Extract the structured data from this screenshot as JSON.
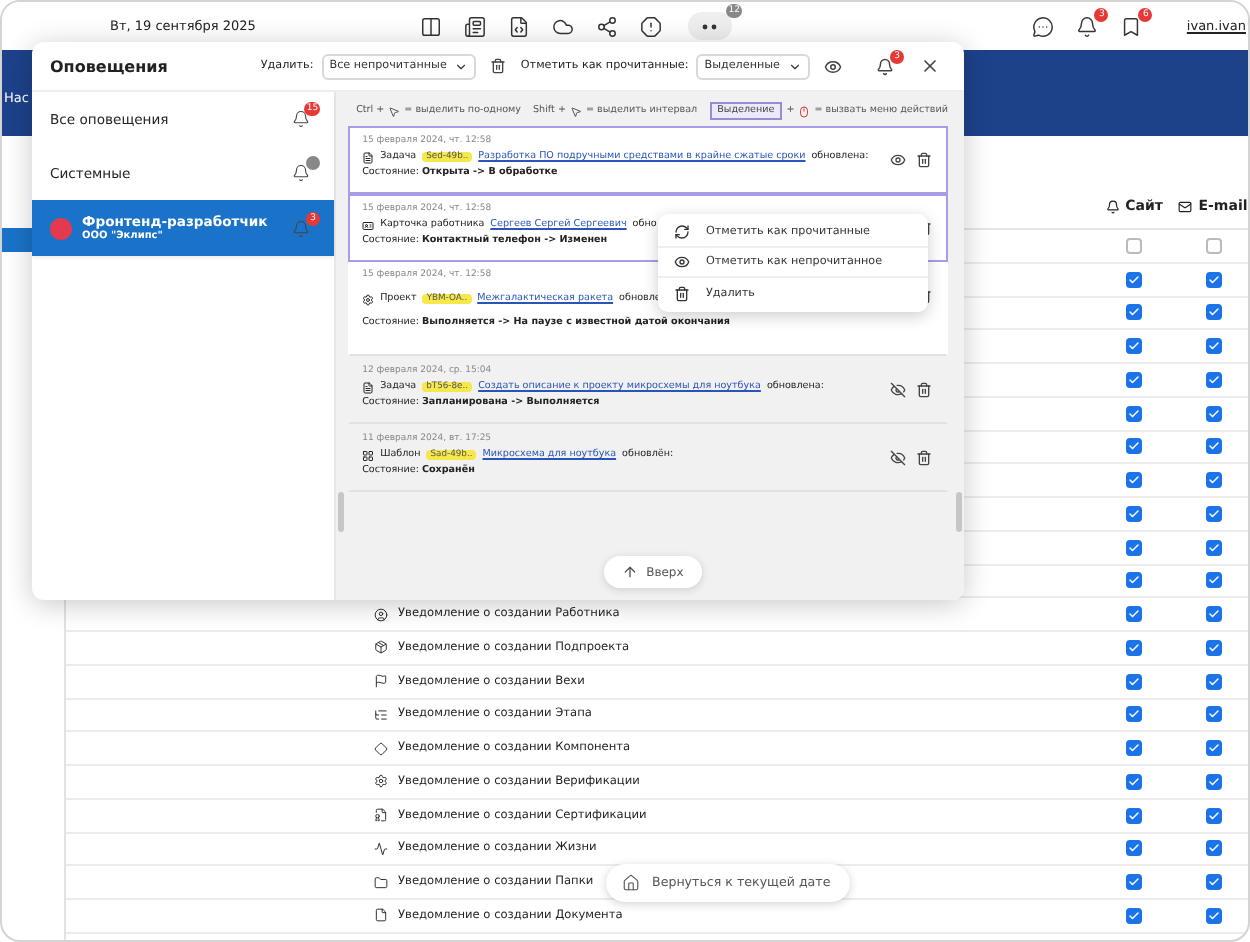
{
  "topbar": {
    "date": "Вт, 19 сентября 2025",
    "more_badge": "12",
    "notifications_badge": "3",
    "bookmarks_badge": "6",
    "user": "ivan.ivan"
  },
  "nav": {
    "tab": "Нас"
  },
  "table": {
    "columns": [
      {
        "label": "Сайт"
      },
      {
        "label": "E-mail"
      }
    ],
    "rows": [
      {
        "site": false,
        "email": false
      },
      {
        "site": true,
        "email": true
      },
      {
        "site": true,
        "email": true
      },
      {
        "site": true,
        "email": true
      },
      {
        "site": true,
        "email": true
      },
      {
        "site": true,
        "email": true
      },
      {
        "site": true,
        "email": true
      },
      {
        "site": true,
        "email": true
      },
      {
        "site": true,
        "email": true
      },
      {
        "site": true,
        "email": true
      },
      {
        "site": true,
        "email": true
      },
      {
        "label": "Уведомление о создании Работника",
        "site": true,
        "email": true
      },
      {
        "label": "Уведомление о создании Подпроекта",
        "site": true,
        "email": true
      },
      {
        "label": "Уведомление о создании Вехи",
        "site": true,
        "email": true
      },
      {
        "label": "Уведомление о создании Этапа",
        "site": true,
        "email": true
      },
      {
        "label": "Уведомление о создании Компонента",
        "site": true,
        "email": true
      },
      {
        "label": "Уведомление о создании Верификации",
        "site": true,
        "email": true
      },
      {
        "label": "Уведомление о создании Сертификации",
        "site": true,
        "email": true
      },
      {
        "label": "Уведомление о создании Жизни",
        "site": true,
        "email": true
      },
      {
        "label": "Уведомление о создании Папки",
        "site": true,
        "email": true
      },
      {
        "label": "Уведомление о создании Документа",
        "site": true,
        "email": true
      }
    ]
  },
  "popup": {
    "title": "Оповещения",
    "delete_label": "Удалить:",
    "delete_select": "Все непрочитанные",
    "mark_label": "Отметить как прочитанные:",
    "mark_select": "Выделенные",
    "bell_badge": "3",
    "channels": [
      {
        "name": "Все оповещения",
        "has_unread": true,
        "badge": "15",
        "selected": false
      },
      {
        "name": "Системные",
        "has_unread": false,
        "selected": false
      },
      {
        "name": "Фронтенд-разработчик",
        "org": "ООО \"Эклипс\"",
        "has_unread": true,
        "badge": "3",
        "selected": true
      }
    ],
    "hints": [
      {
        "kind": "key",
        "key": "Ctrl +",
        "action": "= выделить по-одному"
      },
      {
        "kind": "key",
        "key": "Shift +",
        "action": "= выделить интервал"
      },
      {
        "kind": "chip",
        "key": "Выделение",
        "plus": "+",
        "action": "= вызвать меню действий"
      }
    ],
    "cards": [
      {
        "date": "15 февраля 2024, чт. 12:58",
        "type": "Задача",
        "tag": "Sed-49b..",
        "link": "Разработка ПО подручными средствами в крайне сжатые сроки",
        "verb": "обновлена:",
        "state": "Состояние: **Открыта -> В обработке**",
        "selected": true,
        "read": false
      },
      {
        "date": "15 февраля 2024, чт. 12:58",
        "type": "Карточка работника",
        "link": "Сергеев Сергей Сергеевич",
        "verb": "обно",
        "state": "Состояние: **Контактный телефон -> Изменен**",
        "selected": true,
        "read": false
      },
      {
        "date": "15 февраля 2024, чт. 12:58",
        "type": "Проект",
        "tag": "YBM-OA..",
        "link": "Межгалактическая ракета",
        "verb": "обновле",
        "state": "Состояние: **Выполняется -> На паузе с известной датой окончания**",
        "selected": false,
        "read": false
      },
      {
        "date": "12 февраля 2024, ср. 15:04",
        "type": "Задача",
        "tag": "bT56-8e..",
        "link": "Создать описание к проекту микросхемы для ноутбука",
        "verb": "обновлена:",
        "state": "Состояние: **Запланирована -> Выполняется**",
        "selected": false,
        "read": true
      },
      {
        "date": "11 февраля 2024, вт. 17:25",
        "type": "Шаблон",
        "tag": "Sad-49b..",
        "link": "Микросхема для ноутбука",
        "verb": "обновлён:",
        "state": "Состояние: **Сохранён**",
        "selected": false,
        "read": true
      }
    ],
    "up_button": "Вверх",
    "context_menu": [
      "Отметить как прочитанные",
      "Отметить как непрочитанное",
      "Удалить"
    ]
  },
  "today_button": "Вернуться к текущей дате"
}
